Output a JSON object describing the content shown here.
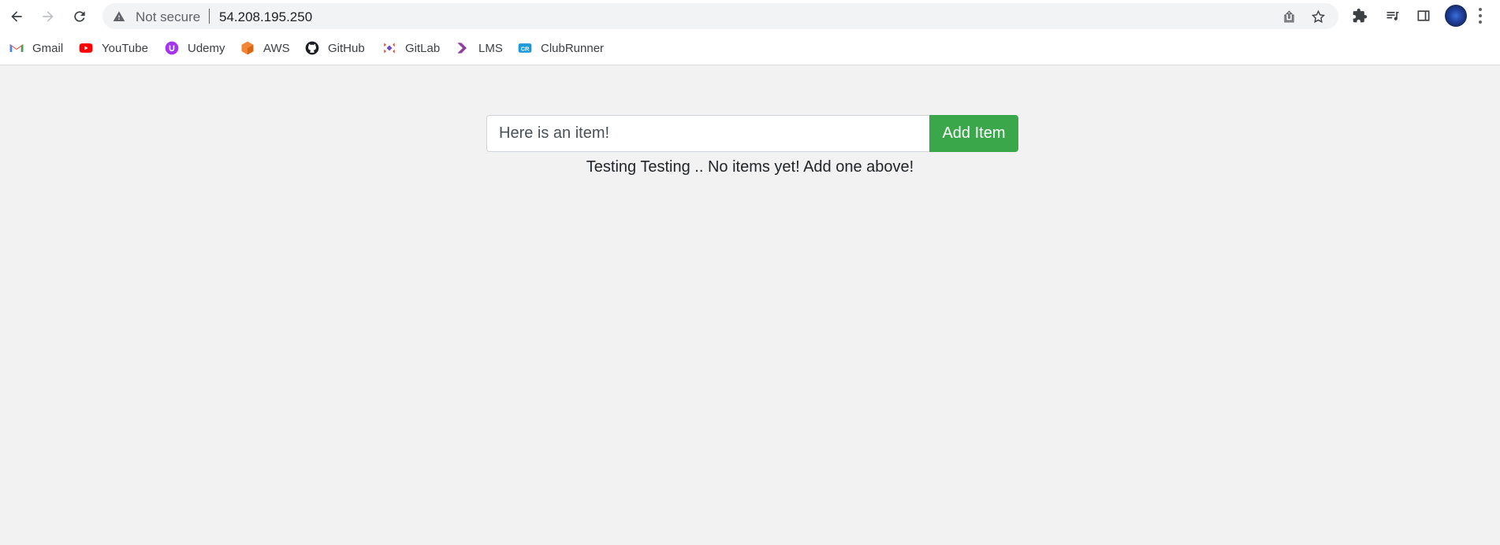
{
  "browser": {
    "security_label": "Not secure",
    "url": "54.208.195.250"
  },
  "bookmarks": [
    {
      "label": "Gmail",
      "icon": "gmail-icon"
    },
    {
      "label": "YouTube",
      "icon": "youtube-icon"
    },
    {
      "label": "Udemy",
      "icon": "udemy-icon"
    },
    {
      "label": "AWS",
      "icon": "aws-icon"
    },
    {
      "label": "GitHub",
      "icon": "github-icon"
    },
    {
      "label": "GitLab",
      "icon": "gitlab-icon"
    },
    {
      "label": "LMS",
      "icon": "lms-icon"
    },
    {
      "label": "ClubRunner",
      "icon": "clubrunner-icon"
    }
  ],
  "app": {
    "input_value": "Here is an item!",
    "add_button_label": "Add Item",
    "empty_message": "Testing Testing .. No items yet! Add one above!"
  },
  "colors": {
    "add_button": "#3aa84a",
    "page_background": "#f2f2f2"
  }
}
